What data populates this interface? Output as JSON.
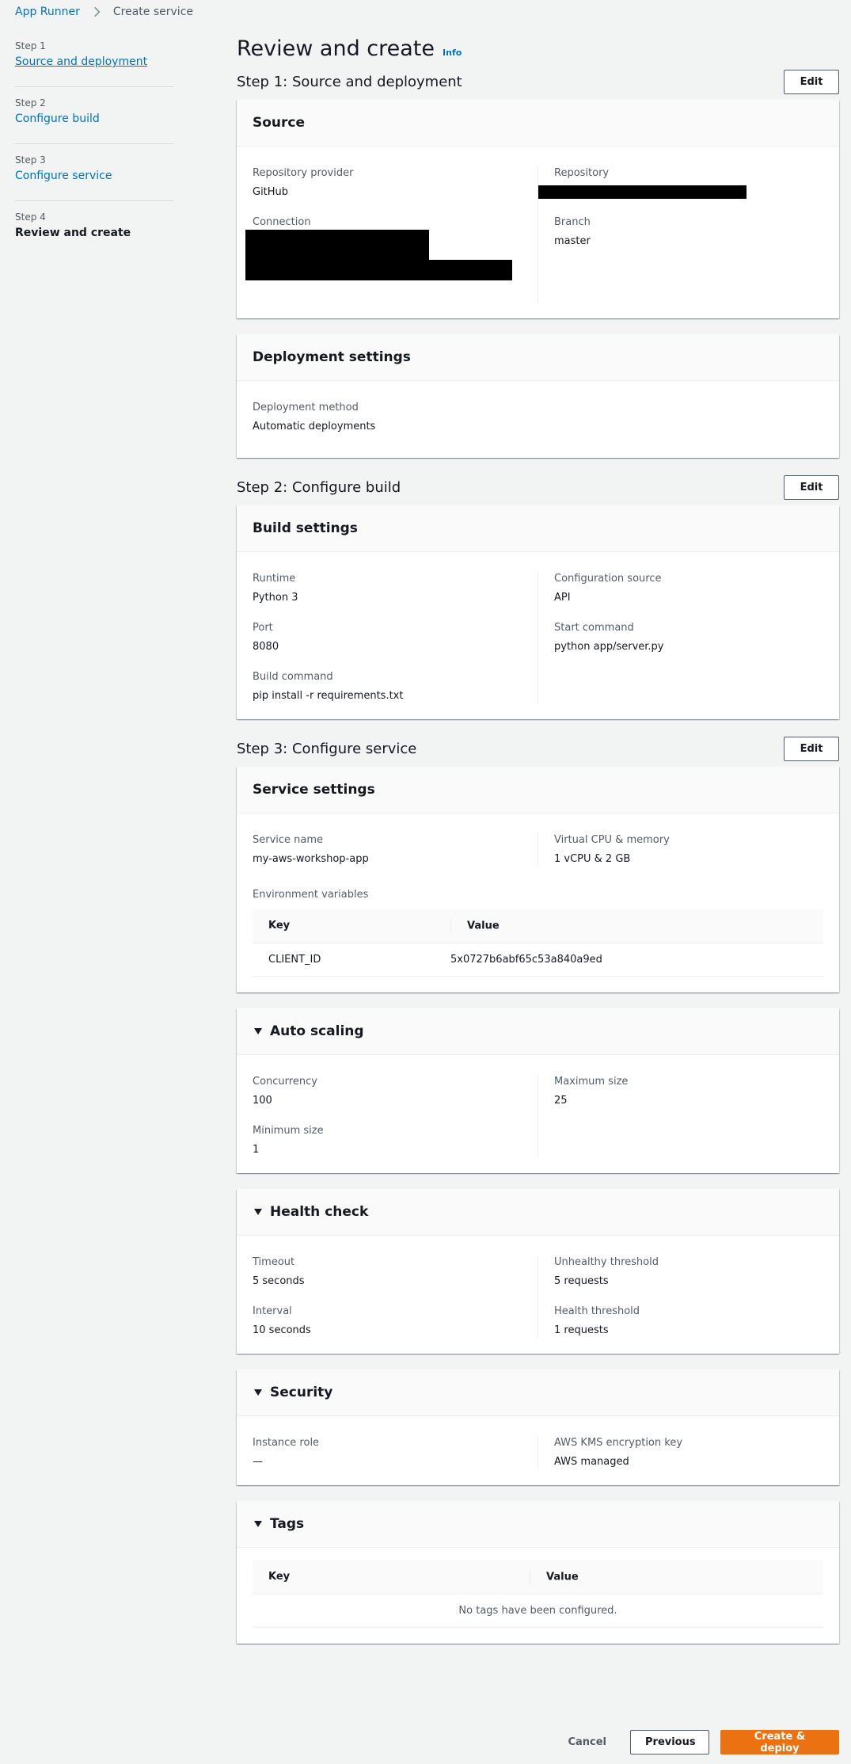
{
  "breadcrumb": {
    "root": "App Runner",
    "current": "Create service"
  },
  "steps": [
    {
      "num": "Step 1",
      "name": "Source and deployment"
    },
    {
      "num": "Step 2",
      "name": "Configure build"
    },
    {
      "num": "Step 3",
      "name": "Configure service"
    },
    {
      "num": "Step 4",
      "name": "Review and create"
    }
  ],
  "page": {
    "title": "Review and create",
    "info": "Info"
  },
  "step1": {
    "title": "Step 1: Source and deployment",
    "edit": "Edit",
    "source": {
      "title": "Source",
      "repo_provider_label": "Repository provider",
      "repo_provider_value": "GitHub",
      "repository_label": "Repository",
      "connection_label": "Connection",
      "branch_label": "Branch",
      "branch_value": "master"
    },
    "deployment": {
      "title": "Deployment settings",
      "method_label": "Deployment method",
      "method_value": "Automatic deployments"
    }
  },
  "step2": {
    "title": "Step 2: Configure build",
    "edit": "Edit",
    "build": {
      "title": "Build settings",
      "runtime_label": "Runtime",
      "runtime_value": "Python 3",
      "port_label": "Port",
      "port_value": "8080",
      "build_cmd_label": "Build command",
      "build_cmd_value": "pip install -r requirements.txt",
      "config_source_label": "Configuration source",
      "config_source_value": "API",
      "start_cmd_label": "Start command",
      "start_cmd_value": "python app/server.py"
    }
  },
  "step3": {
    "title": "Step 3: Configure service",
    "edit": "Edit",
    "service": {
      "title": "Service settings",
      "name_label": "Service name",
      "name_value": "my-aws-workshop-app",
      "cpu_label": "Virtual CPU & memory",
      "cpu_value": "1 vCPU & 2 GB",
      "env_label": "Environment variables",
      "env_key_header": "Key",
      "env_value_header": "Value",
      "env_rows": [
        {
          "key": "CLIENT_ID",
          "value": "5x0727b6abf65c53a840a9ed"
        }
      ]
    },
    "autoscaling": {
      "title": "Auto scaling",
      "concurrency_label": "Concurrency",
      "concurrency_value": "100",
      "min_label": "Minimum size",
      "min_value": "1",
      "max_label": "Maximum size",
      "max_value": "25"
    },
    "health": {
      "title": "Health check",
      "timeout_label": "Timeout",
      "timeout_value": "5 seconds",
      "interval_label": "Interval",
      "interval_value": "10 seconds",
      "unhealthy_label": "Unhealthy threshold",
      "unhealthy_value": "5 requests",
      "healthy_label": "Health threshold",
      "healthy_value": "1 requests"
    },
    "security": {
      "title": "Security",
      "role_label": "Instance role",
      "role_value": "—",
      "kms_label": "AWS KMS encryption key",
      "kms_value": "AWS managed"
    },
    "tags": {
      "title": "Tags",
      "key_header": "Key",
      "value_header": "Value",
      "empty": "No tags have been configured."
    }
  },
  "footer": {
    "cancel": "Cancel",
    "previous": "Previous",
    "create": "Create & deploy"
  }
}
